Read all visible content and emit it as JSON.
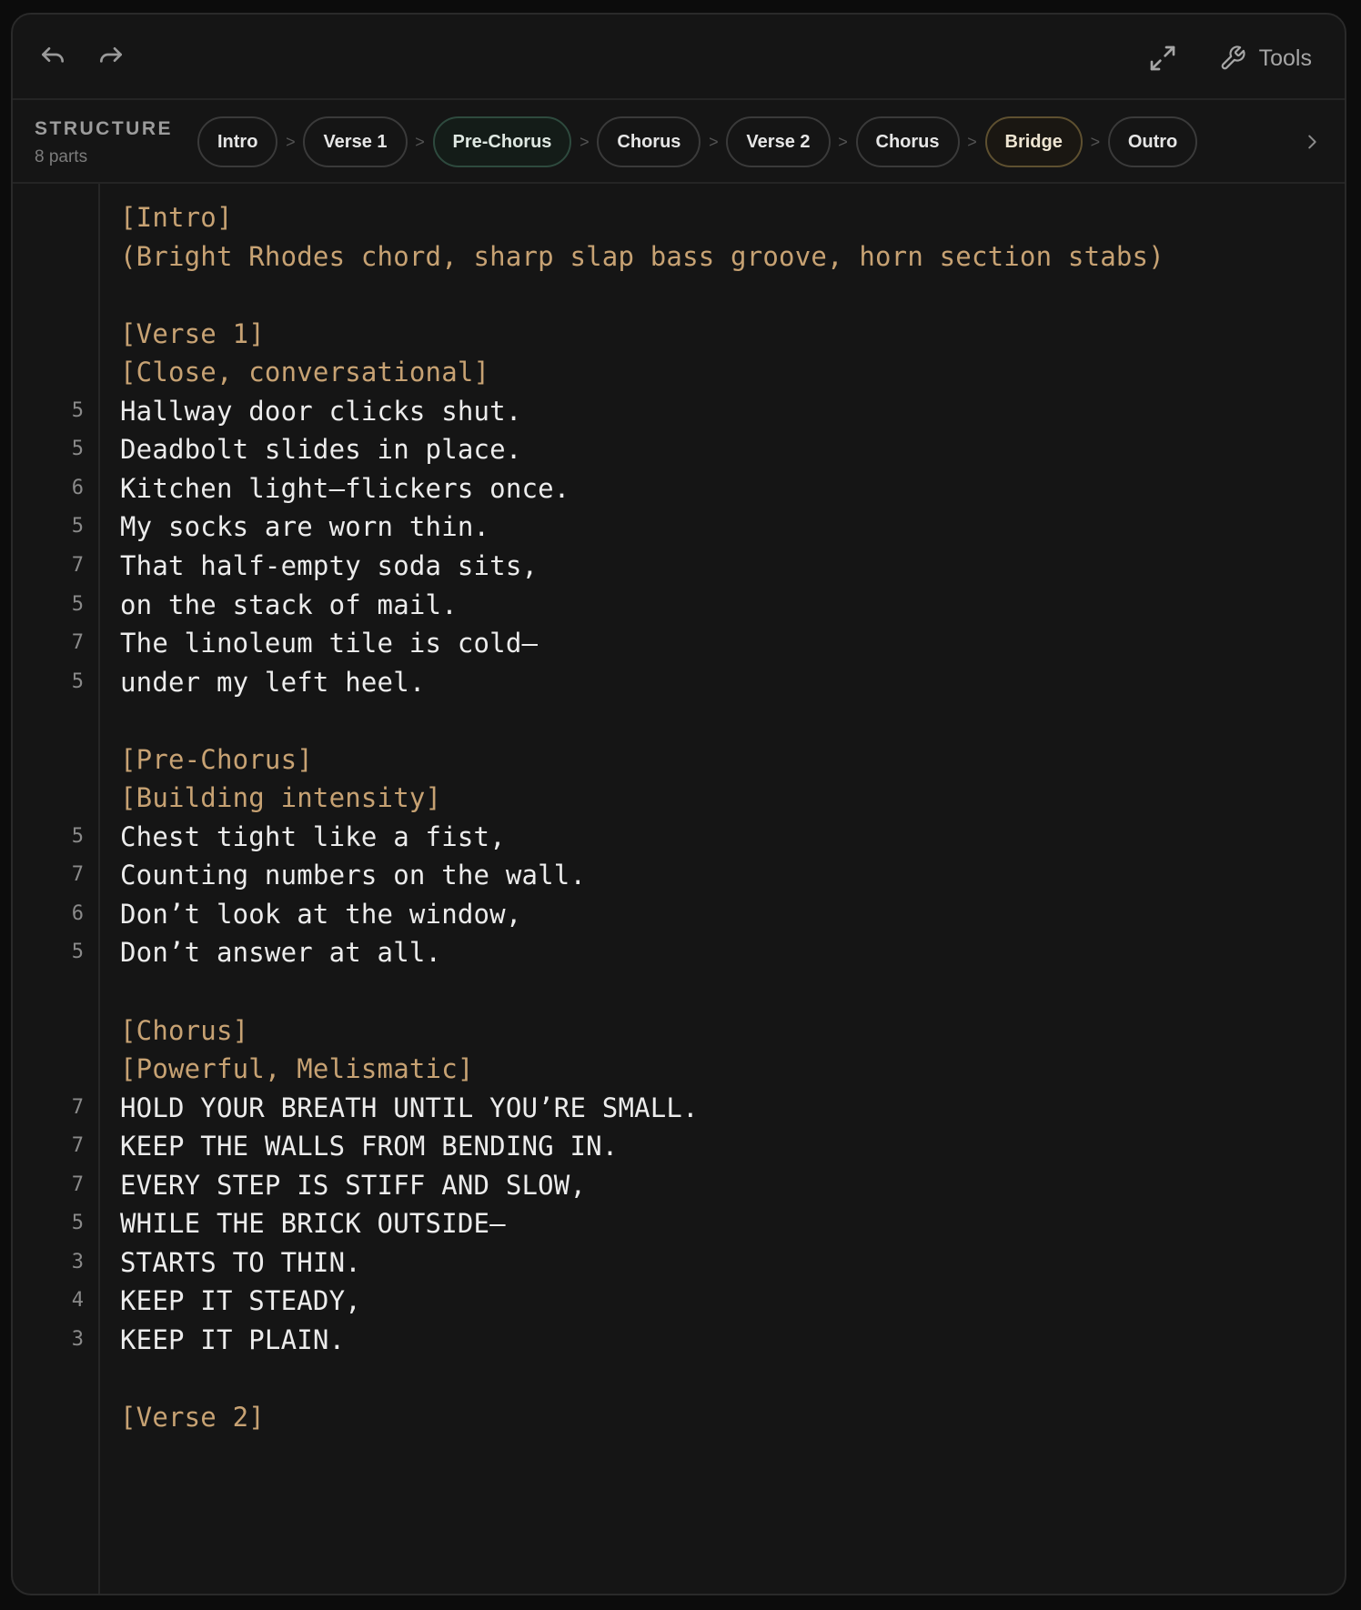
{
  "toolbar": {
    "undo_icon": "undo-icon",
    "redo_icon": "redo-icon",
    "expand_icon": "expand-icon",
    "tools_icon": "wrench-icon",
    "tools_label": "Tools"
  },
  "structure": {
    "title": "STRUCTURE",
    "count": "8 parts",
    "separator": ">",
    "parts": [
      {
        "label": "Intro"
      },
      {
        "label": "Verse 1"
      },
      {
        "label": "Pre-Chorus"
      },
      {
        "label": "Chorus"
      },
      {
        "label": "Verse 2"
      },
      {
        "label": "Chorus"
      },
      {
        "label": "Bridge"
      },
      {
        "label": "Outro"
      }
    ]
  },
  "colors": {
    "tag_text": "#c7a273",
    "lyric_text": "#ececec",
    "pre_chorus_chip": "#2e4a3e",
    "bridge_chip": "#5e5030"
  },
  "lines": [
    {
      "n": "",
      "text": "[Intro]",
      "kind": "tag"
    },
    {
      "n": "",
      "text": "(Bright Rhodes chord, sharp slap bass groove, horn section stabs)",
      "kind": "tag"
    },
    {
      "n": "",
      "text": "",
      "kind": "blank"
    },
    {
      "n": "",
      "text": "[Verse 1]",
      "kind": "tag"
    },
    {
      "n": "",
      "text": "[Close, conversational]",
      "kind": "tag"
    },
    {
      "n": "5",
      "text": "Hallway door clicks shut.",
      "kind": "lyric"
    },
    {
      "n": "5",
      "text": "Deadbolt slides in place.",
      "kind": "lyric"
    },
    {
      "n": "6",
      "text": "Kitchen light—flickers once.",
      "kind": "lyric"
    },
    {
      "n": "5",
      "text": "My socks are worn thin.",
      "kind": "lyric"
    },
    {
      "n": "7",
      "text": "That half-empty soda sits,",
      "kind": "lyric"
    },
    {
      "n": "5",
      "text": "on the stack of mail.",
      "kind": "lyric"
    },
    {
      "n": "7",
      "text": "The linoleum tile is cold—",
      "kind": "lyric"
    },
    {
      "n": "5",
      "text": "under my left heel.",
      "kind": "lyric"
    },
    {
      "n": "",
      "text": "",
      "kind": "blank"
    },
    {
      "n": "",
      "text": "[Pre-Chorus]",
      "kind": "tag"
    },
    {
      "n": "",
      "text": "[Building intensity]",
      "kind": "tag"
    },
    {
      "n": "5",
      "text": "Chest tight like a fist,",
      "kind": "lyric"
    },
    {
      "n": "7",
      "text": "Counting numbers on the wall.",
      "kind": "lyric"
    },
    {
      "n": "6",
      "text": "Don’t look at the window,",
      "kind": "lyric"
    },
    {
      "n": "5",
      "text": "Don’t answer at all.",
      "kind": "lyric"
    },
    {
      "n": "",
      "text": "",
      "kind": "blank"
    },
    {
      "n": "",
      "text": "[Chorus]",
      "kind": "tag"
    },
    {
      "n": "",
      "text": "[Powerful, Melismatic]",
      "kind": "tag"
    },
    {
      "n": "7",
      "text": "HOLD YOUR BREATH UNTIL YOU’RE SMALL.",
      "kind": "lyric"
    },
    {
      "n": "7",
      "text": "KEEP THE WALLS FROM BENDING IN.",
      "kind": "lyric"
    },
    {
      "n": "7",
      "text": "EVERY STEP IS STIFF AND SLOW,",
      "kind": "lyric"
    },
    {
      "n": "5",
      "text": "WHILE THE BRICK OUTSIDE—",
      "kind": "lyric"
    },
    {
      "n": "3",
      "text": "STARTS TO THIN.",
      "kind": "lyric"
    },
    {
      "n": "4",
      "text": "KEEP IT STEADY,",
      "kind": "lyric"
    },
    {
      "n": "3",
      "text": "KEEP IT PLAIN.",
      "kind": "lyric"
    },
    {
      "n": "",
      "text": "",
      "kind": "blank"
    },
    {
      "n": "",
      "text": "[Verse 2]",
      "kind": "tag"
    }
  ]
}
